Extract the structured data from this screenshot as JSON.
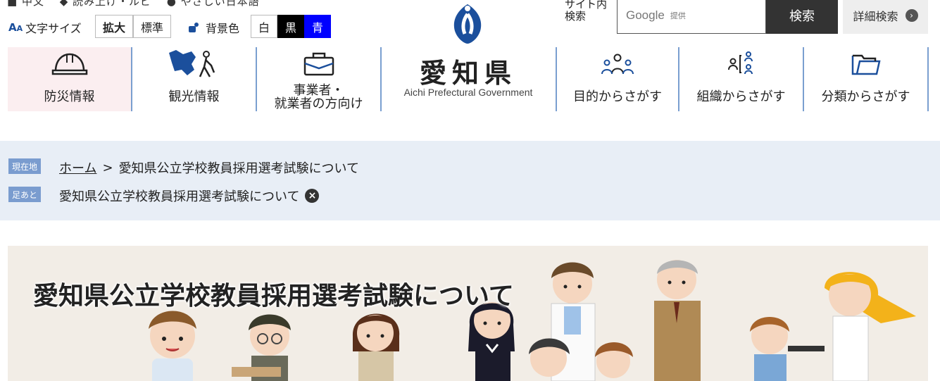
{
  "utility": {
    "top_cut_text": "■ 中文　 ◆ 読み上げ・ルビ　 ● やさしい日本語",
    "font_size": {
      "label": "文字サイズ",
      "enlarge": "拡大",
      "standard": "標準"
    },
    "bg_color": {
      "label": "背景色",
      "white": "白",
      "black": "黒",
      "blue": "青"
    },
    "colors": {
      "black": "#000000",
      "blue": "#0000ff"
    }
  },
  "search": {
    "label_line1": "サイト内",
    "label_line2": "検索",
    "google": "Google",
    "powered": "提供",
    "button": "検索",
    "advanced": "詳細検索"
  },
  "nav": {
    "disaster": "防災情報",
    "tourism": "観光情報",
    "business_line1": "事業者・",
    "business_line2": "就業者の方向け",
    "purpose": "目的からさがす",
    "organization": "組織からさがす",
    "category": "分類からさがす"
  },
  "logo": {
    "kanji": "愛知県",
    "english": "Aichi Prefectural Government"
  },
  "breadcrumb": {
    "current_tag": "現在地",
    "home": "ホーム",
    "separator": ">",
    "current": "愛知県公立学校教員採用選考試験について",
    "history_tag": "足あと",
    "history_item": "愛知県公立学校教員採用選考試験について"
  },
  "hero": {
    "title": "愛知県公立学校教員採用選考試験について"
  },
  "theme": {
    "nav_separator": "#7a9fd0",
    "crumb_bg": "#e8eef6",
    "tag_bg": "#7a9ccf",
    "accent_blue": "#1b4f9c"
  }
}
